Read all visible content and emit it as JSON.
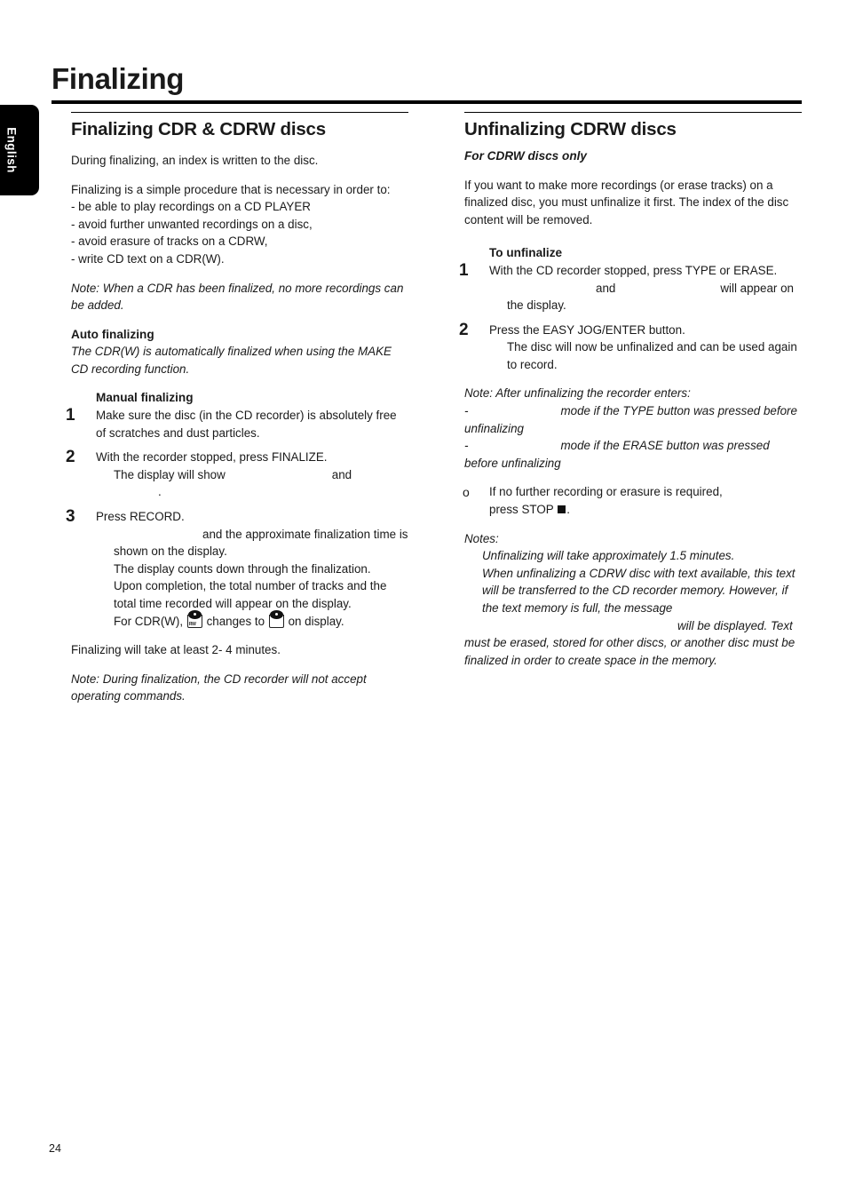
{
  "language_tab": {
    "label": "English"
  },
  "page_title": "Finalizing",
  "page_number": "24",
  "left_column": {
    "heading": "Finalizing CDR & CDRW discs",
    "intro_1": "During finalizing, an index is written to the disc.",
    "intro_2": "Finalizing is a simple procedure that is necessary in order to:",
    "bullets": [
      "- be able to play recordings on a CD PLAYER",
      "- avoid further unwanted recordings on a disc,",
      "- avoid erasure of tracks on a CDRW,",
      "- write CD text on a CDR(W)."
    ],
    "note_1": "Note: When a CDR has been finalized, no more recordings can be added.",
    "auto_heading": "Auto finalizing",
    "auto_text": "The CDR(W) is automatically finalized when using the MAKE CD recording function.",
    "manual_heading": "Manual finalizing",
    "steps": [
      {
        "num": "1",
        "text": "Make sure the disc (in the CD recorder) is absolutely free of scratches and dust particles."
      },
      {
        "num": "2",
        "text": "With the recorder stopped, press FINALIZE.",
        "sub_prefix": "The display will show",
        "sub_mid": "and",
        "sub_suffix": "."
      },
      {
        "num": "3",
        "text": "Press RECORD.",
        "sub_lines": [
          "and the approximate finalization time is shown on the display.",
          "The display counts down through the finalization.",
          "Upon completion, the total number of tracks and the total time recorded will appear on the display."
        ],
        "icon_line_prefix": "For CDR(W),",
        "icon_line_mid": "changes to",
        "icon_line_suffix": "on display."
      }
    ],
    "duration": "Finalizing will take at least 2- 4 minutes.",
    "note_2": "Note: During finalization, the CD recorder will not accept operating  commands."
  },
  "right_column": {
    "heading": "Unfinalizing CDRW discs",
    "subhead": "For CDRW discs only",
    "intro": "If you want to make more recordings (or erase tracks) on a finalized disc, you must unfinalize it first. The index of the disc content will be removed.",
    "to_unfinalize_heading": "To unfinalize",
    "steps": [
      {
        "num": "1",
        "text": "With the CD recorder stopped, press TYPE or ERASE.",
        "sub_mid": "and",
        "sub_suffix": "will appear on the display."
      },
      {
        "num": "2",
        "text": "Press the EASY JOG/ENTER button.",
        "sub": "The disc will now be unfinalized and can be used again to record."
      }
    ],
    "note_heading": "Note: After unfinalizing the recorder enters:",
    "note_items": [
      {
        "dash": "-",
        "text": "mode if the TYPE button was pressed before unfinalizing"
      },
      {
        "dash": "-",
        "text": "mode if the ERASE button was pressed before unfinalizing"
      }
    ],
    "bullet_marker": "o",
    "bullet_line_1": "If no further recording or erasure is required,",
    "bullet_line_2_prefix": "press STOP",
    "bullet_line_2_suffix": ".",
    "notes_heading": "Notes:",
    "notes": [
      "Unfinalizing will take approximately 1.5 minutes.",
      "When unfinalizing a CDRW disc with text available, this text will be transferred to the CD recorder memory. However, if the text memory is full, the message"
    ],
    "notes_tail": "will be displayed. Text must be erased, stored for other discs, or another disc must be finalized in order to create space in the memory."
  },
  "icons": {
    "disc_rw_label": "RW",
    "disc_cdr": "disc-icon",
    "stop_square": "stop-square-icon"
  }
}
